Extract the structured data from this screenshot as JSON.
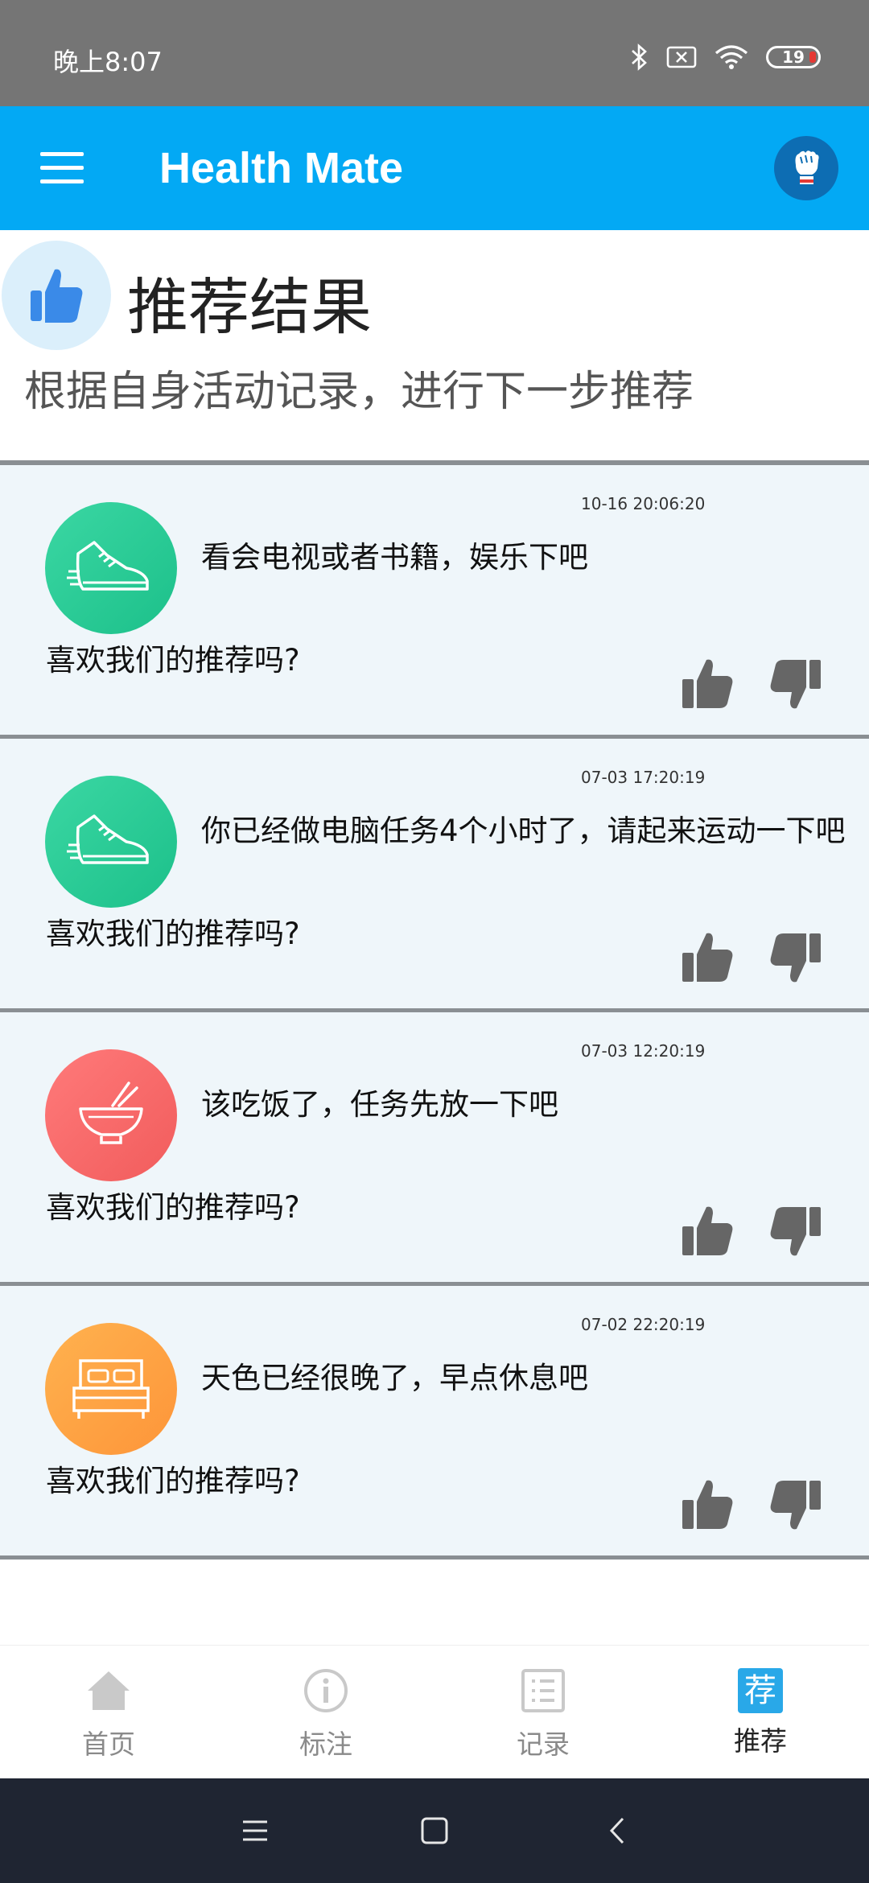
{
  "status_bar": {
    "time": "晚上8:07",
    "battery": "19"
  },
  "app_bar": {
    "title": "Health Mate"
  },
  "header": {
    "title": "推荐结果",
    "subtitle": "根据自身活动记录，进行下一步推荐"
  },
  "cards": [
    {
      "timestamp": "10-16 20:06:20",
      "icon": "sneaker-icon",
      "color": "#2ccd96",
      "message": "看会电视或者书籍，娱乐下吧",
      "question": "喜欢我们的推荐吗?"
    },
    {
      "timestamp": "07-03 17:20:19",
      "icon": "sneaker-icon",
      "color": "#2ccd96",
      "message": "你已经做电脑任务4个小时了，请起来运动一下吧",
      "question": "喜欢我们的推荐吗?"
    },
    {
      "timestamp": "07-03 12:20:19",
      "icon": "bowl-chopsticks-icon",
      "color": "#f76868",
      "message": "该吃饭了，任务先放一下吧",
      "question": "喜欢我们的推荐吗?"
    },
    {
      "timestamp": "07-02 22:20:19",
      "icon": "bed-icon",
      "color": "#fea245",
      "message": "天色已经很晚了，早点休息吧",
      "question": "喜欢我们的推荐吗?"
    }
  ],
  "bottom_nav": {
    "items": [
      {
        "label": "首页",
        "icon": "home-icon"
      },
      {
        "label": "标注",
        "icon": "info-icon"
      },
      {
        "label": "记录",
        "icon": "list-icon"
      },
      {
        "label": "推荐",
        "icon": "recommend-icon",
        "glyph": "荐",
        "active": true
      }
    ]
  },
  "colors": {
    "appbar": "#03a9f4",
    "statusbar": "#757575",
    "card_bg": "#eff6fa",
    "active_nav": "#29a8e8"
  }
}
